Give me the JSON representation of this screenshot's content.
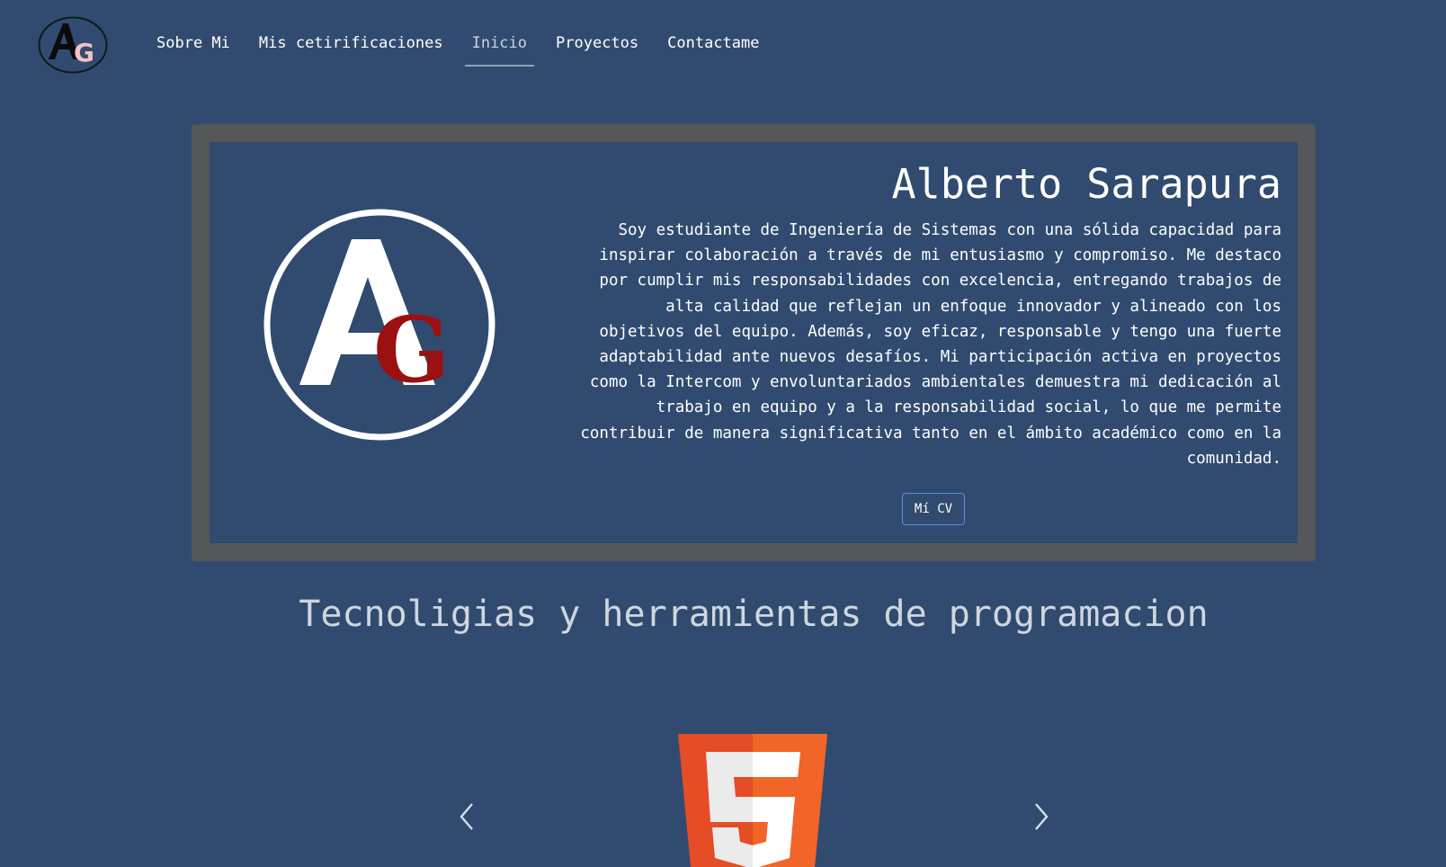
{
  "nav": {
    "logo_text": "AG",
    "links": [
      {
        "label": "Sobre Mi",
        "active": false
      },
      {
        "label": "Mis cetirificaciones",
        "active": false
      },
      {
        "label": "Inicio",
        "active": true
      },
      {
        "label": "Proyectos",
        "active": false
      },
      {
        "label": "Contactame",
        "active": false
      }
    ]
  },
  "hero": {
    "logo_text": "AG",
    "name": "Alberto Sarapura",
    "bio": "Soy estudiante de Ingeniería de Sistemas con una sólida capacidad para inspirar colaboración a través de mi entusiasmo y compromiso. Me destaco por cumplir mis responsabilidades con excelencia, entregando trabajos de alta calidad que reflejan un enfoque innovador y alineado con los objetivos del equipo. Además, soy eficaz, responsable y tengo una fuerte adaptabilidad ante nuevos desafíos. Mi participación activa en proyectos como la Intercom y envoluntariados ambientales demuestra mi dedicación al trabajo en equipo y a la responsabilidad social, lo que me permite contribuir de manera significativa tanto en el ámbito académico como en la comunidad.",
    "cv_button": "Mí CV"
  },
  "technologies": {
    "title": "Tecnoligias y herramientas de programacion",
    "current_item_icon": "html5-logo",
    "current_item_glyph": "5",
    "prev_icon": "chevron-left-icon",
    "next_icon": "chevron-right-icon"
  },
  "colors": {
    "background": "#304b6f",
    "frame": "#555759",
    "accent_red": "#9b1010",
    "html5_orange": "#e44d26",
    "html5_light_orange": "#f16529",
    "button_border": "#5b8ee0"
  }
}
